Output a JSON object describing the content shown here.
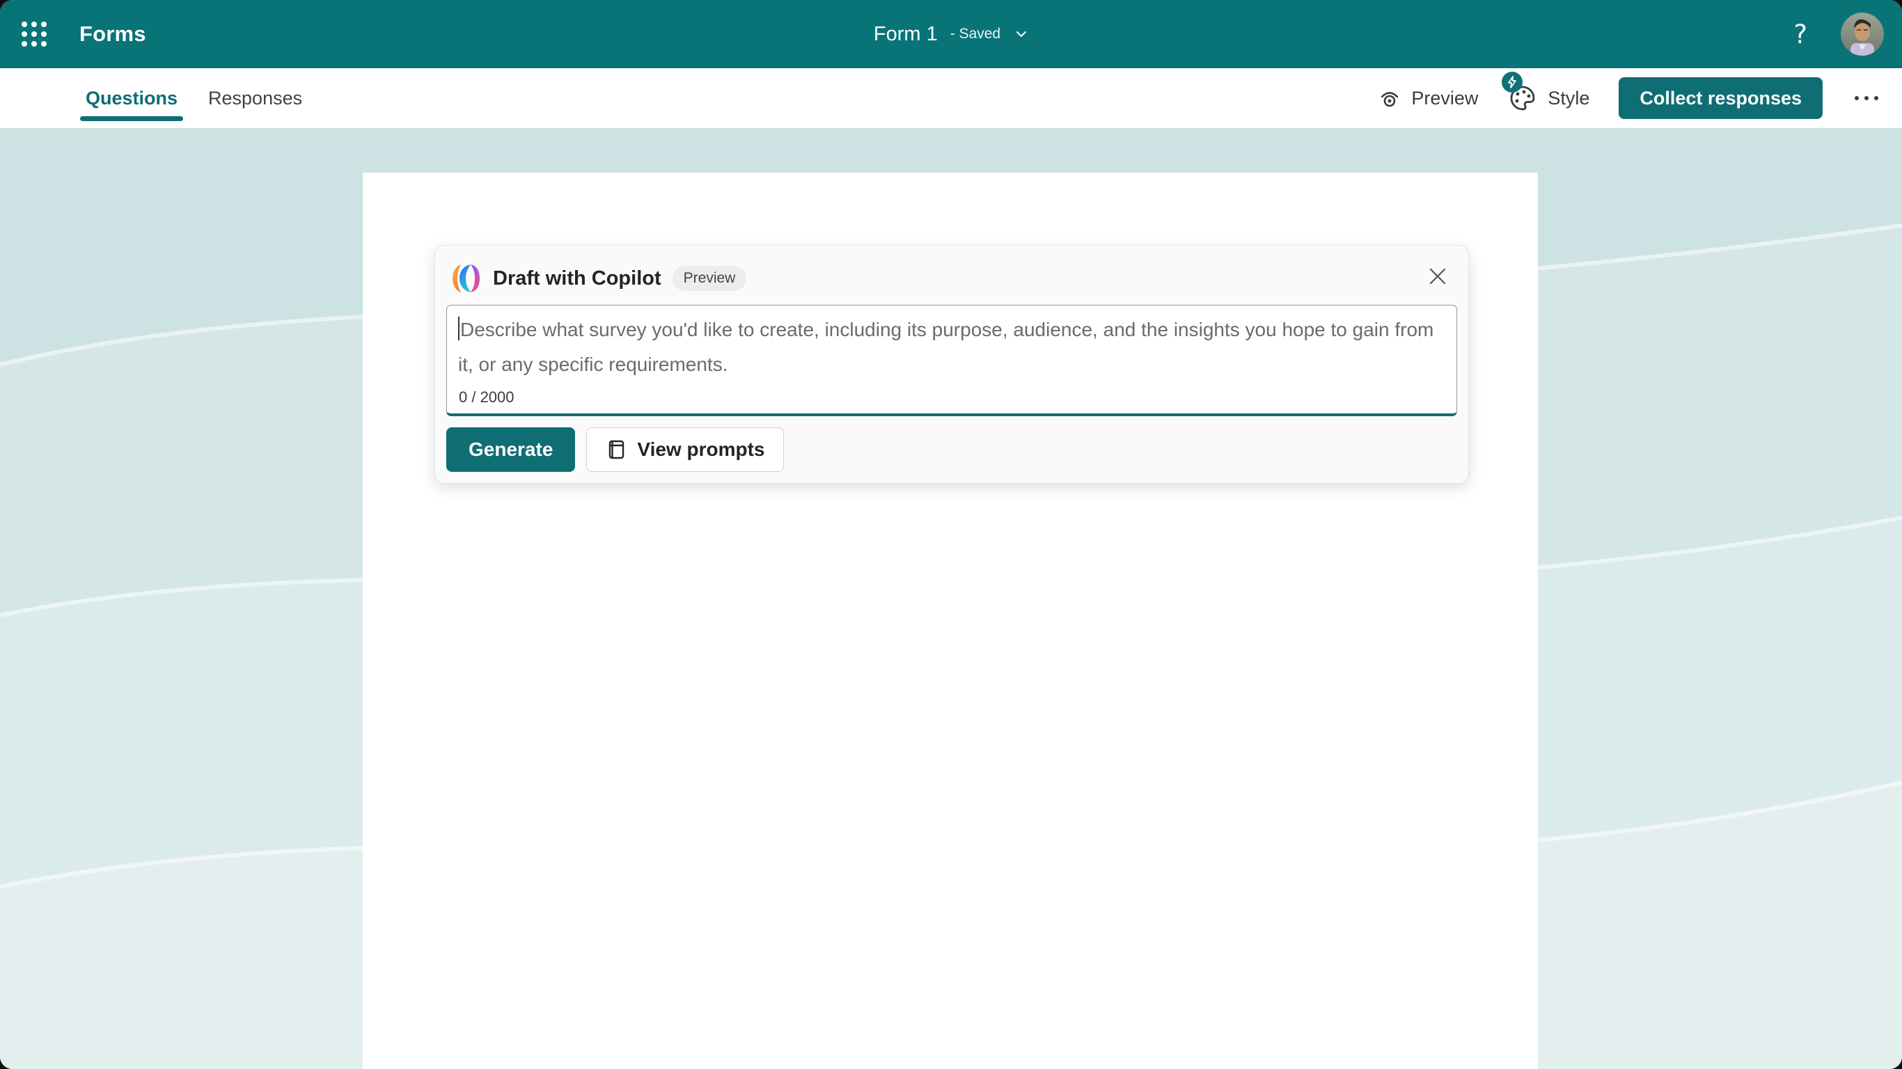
{
  "header": {
    "app_name": "Forms",
    "form_title": "Form 1",
    "save_status": "- Saved",
    "help_glyph": "?"
  },
  "tabs": {
    "questions": "Questions",
    "responses": "Responses"
  },
  "toolbar": {
    "preview_label": "Preview",
    "style_label": "Style",
    "collect_label": "Collect responses"
  },
  "dialog": {
    "title": "Draft with Copilot",
    "badge_label": "Preview",
    "placeholder": "Describe what survey you'd like to create, including its purpose, audience, and the insights you hope to gain from it, or any specific requirements.",
    "char_counter": "0 / 2000",
    "generate_label": "Generate",
    "view_prompts_label": "View prompts"
  },
  "icons": {
    "app_launcher": "waffle-grid",
    "preview": "eye",
    "style": "palette-with-lightning-badge",
    "more": "horizontal-ellipsis",
    "close": "x",
    "view_prompts": "notebook",
    "copilot": "copilot-ribbon"
  },
  "colors": {
    "header_teal": "#087478",
    "accent_teal": "#0E6E74",
    "background_mint": "#CDE2E2",
    "card": "#FFFFFF",
    "dialog_bg": "#FAFAFA",
    "badge_bg": "#EDEDED"
  }
}
